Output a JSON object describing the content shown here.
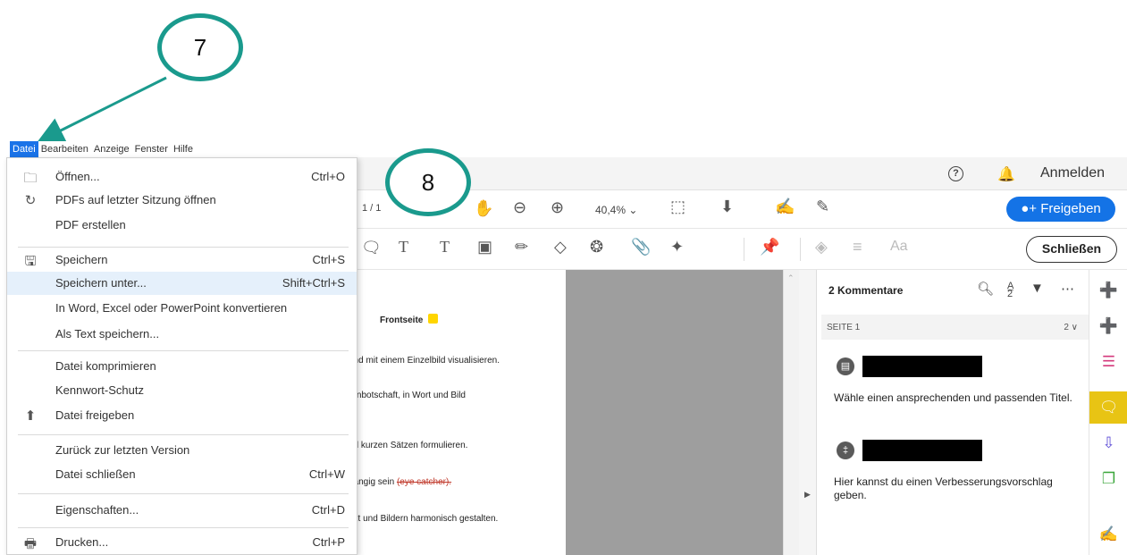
{
  "menubar": {
    "items": [
      "Datei",
      "Bearbeiten",
      "Anzeige",
      "Fenster",
      "Hilfe"
    ]
  },
  "topbar": {
    "help": "?",
    "sign_in": "Anmelden"
  },
  "toolbar1": {
    "page_number": "1 / 1",
    "zoom": "40,4%",
    "share_label": "Freigeben"
  },
  "toolbar2": {
    "close_label": "Schließen",
    "font_label": "Aa"
  },
  "document": {
    "title": "Frontseite",
    "lines": [
      "und mit einem Einzelbild visualisieren.",
      "ernbotschaft, in Wort und Bild",
      "nd kurzen Sätzen formulieren.",
      "gängig sein",
      "ext und Bildern harmonisch gestalten."
    ],
    "strike_text": "(eye catcher)."
  },
  "comments_panel": {
    "title": "2 Kommentare",
    "sort_icon_text": "A̲\n2",
    "page_label": "SEITE 1",
    "page_count": "2 ∨",
    "comments": [
      {
        "text": "Wähle einen ansprechenden und passenden Titel."
      },
      {
        "text": "Hier kannst du einen Verbesserungsvorschlag geben."
      }
    ]
  },
  "file_menu": {
    "items": [
      {
        "icon": "folder-icon",
        "label": "Öffnen...",
        "shortcut": "Ctrl+O"
      },
      {
        "icon": "recent-session-icon",
        "label": "PDFs auf letzter Sitzung öffnen",
        "shortcut": ""
      },
      {
        "icon": "",
        "label": "PDF erstellen",
        "shortcut": ""
      },
      {
        "icon": "save-icon",
        "label": "Speichern",
        "shortcut": "Ctrl+S"
      },
      {
        "icon": "",
        "label": "Speichern unter...",
        "shortcut": "Shift+Ctrl+S"
      },
      {
        "icon": "",
        "label": "In Word, Excel oder PowerPoint konvertieren",
        "shortcut": ""
      },
      {
        "icon": "",
        "label": "Als Text speichern...",
        "shortcut": ""
      },
      {
        "icon": "",
        "label": "Datei komprimieren",
        "shortcut": ""
      },
      {
        "icon": "",
        "label": "Kennwort-Schutz",
        "shortcut": ""
      },
      {
        "icon": "share-icon",
        "label": "Datei freigeben",
        "shortcut": ""
      },
      {
        "icon": "",
        "label": "Zurück zur letzten Version",
        "shortcut": ""
      },
      {
        "icon": "",
        "label": "Datei schließen",
        "shortcut": "Ctrl+W"
      },
      {
        "icon": "",
        "label": "Eigenschaften...",
        "shortcut": "Ctrl+D"
      },
      {
        "icon": "print-icon",
        "label": "Drucken...",
        "shortcut": "Ctrl+P"
      }
    ]
  },
  "callouts": {
    "step7": "7",
    "step8": "8"
  },
  "colors": {
    "accent": "#1473e6",
    "teal": "#1a9a8d",
    "comment_active": "#e8c414",
    "menu_highlight": "#e5f0fb"
  }
}
